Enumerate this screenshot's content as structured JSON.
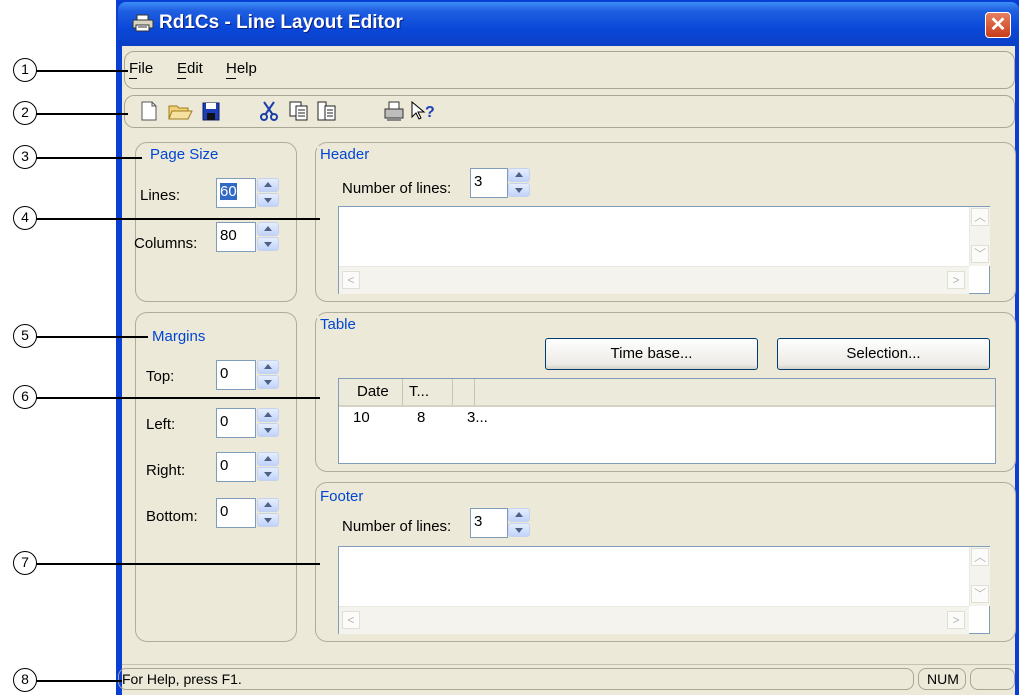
{
  "window": {
    "title": "Rd1Cs - Line Layout Editor",
    "close_glyph": "✕"
  },
  "menu": [
    {
      "label": "File",
      "mnemonic": "F"
    },
    {
      "label": "Edit",
      "mnemonic": "E"
    },
    {
      "label": "Help",
      "mnemonic": "H"
    }
  ],
  "toolbar": {
    "buttons": [
      "new-document-icon",
      "open-folder-icon",
      "save-disk-icon",
      "cut-scissors-icon",
      "copy-icon",
      "paste-icon",
      "print-icon",
      "context-help-icon"
    ]
  },
  "page_size": {
    "title": "Page Size",
    "lines_label": "Lines:",
    "lines_value": "60",
    "columns_label": "Columns:",
    "columns_value": "80"
  },
  "margins": {
    "title": "Margins",
    "top_label": "Top:",
    "top_value": "0",
    "left_label": "Left:",
    "left_value": "0",
    "right_label": "Right:",
    "right_value": "0",
    "bottom_label": "Bottom:",
    "bottom_value": "0"
  },
  "header": {
    "title": "Header",
    "lines_label": "Number of lines:",
    "lines_value": "3"
  },
  "table": {
    "title": "Table",
    "time_base_button": "Time base...",
    "selection_button": "Selection...",
    "columns": [
      "Date",
      "T...",
      ""
    ],
    "rows": [
      [
        "10",
        "8",
        "3..."
      ]
    ]
  },
  "footer": {
    "title": "Footer",
    "lines_label": "Number of lines:",
    "lines_value": "3"
  },
  "statusbar": {
    "help_text": "For Help, press F1.",
    "num_indicator": "NUM"
  },
  "callouts": [
    "1",
    "2",
    "3",
    "4",
    "5",
    "6",
    "7",
    "8"
  ],
  "colors": {
    "titlebar": "#0a48d8",
    "group_title": "#0046d5",
    "client_bg": "#ece9d8"
  }
}
